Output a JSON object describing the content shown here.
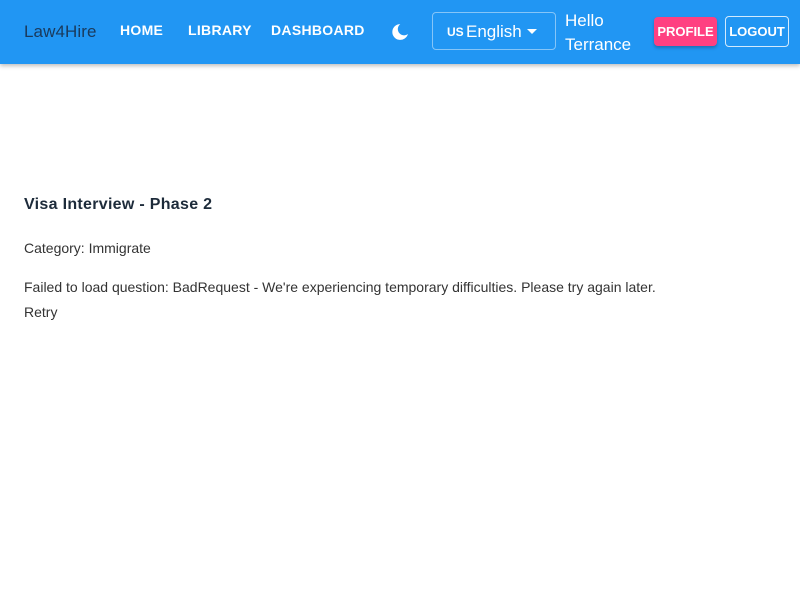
{
  "header": {
    "brand": "Law4Hire",
    "nav": {
      "home": "HOME",
      "library": "LIBRARY",
      "dashboard": "DASHBOARD"
    },
    "theme_icon": "moon-icon",
    "language": {
      "flag": "US",
      "selected": "English"
    },
    "greeting": "Hello Terrance",
    "profile_label": "PROFILE",
    "logout_label": "LOGOUT"
  },
  "main": {
    "title": "Visa Interview - Phase 2",
    "category": "Category: Immigrate",
    "error_message": "Failed to load question: BadRequest - We're experiencing temporary difficulties. Please try again later.",
    "retry_label": "Retry"
  },
  "colors": {
    "appbar": "#2196f3",
    "profile_button": "#ff4081"
  }
}
